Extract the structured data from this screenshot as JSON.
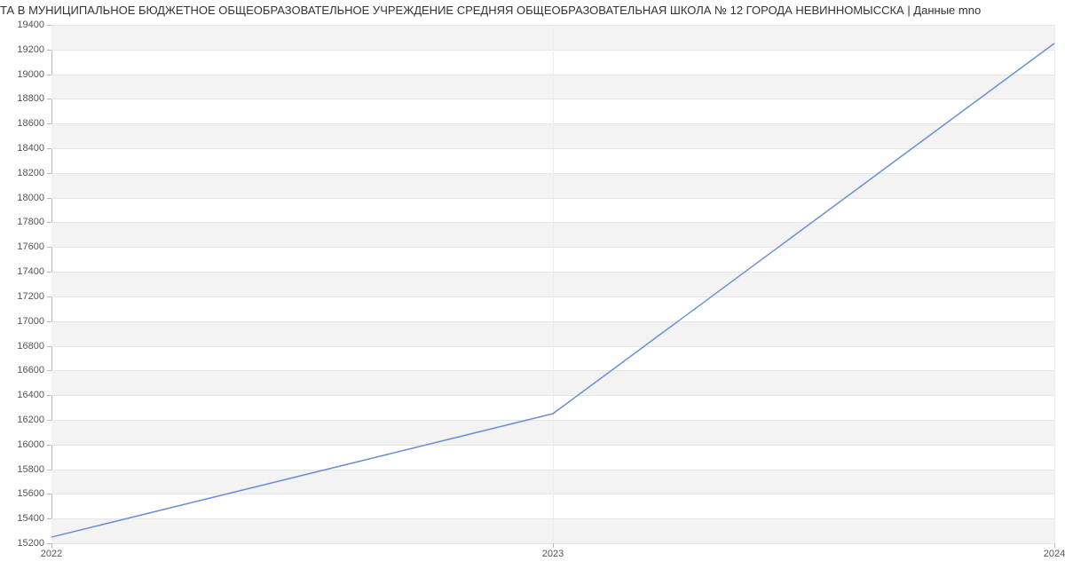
{
  "chart_data": {
    "type": "line",
    "title": "ТА В МУНИЦИПАЛЬНОЕ БЮДЖЕТНОЕ ОБЩЕОБРАЗОВАТЕЛЬНОЕ УЧРЕЖДЕНИЕ СРЕДНЯЯ ОБЩЕОБРАЗОВАТЕЛЬНАЯ ШКОЛА № 12 ГОРОДА НЕВИННОМЫССКА | Данные mno",
    "xlabel": "",
    "ylabel": "",
    "x": [
      2022,
      2023,
      2024
    ],
    "values": [
      15250,
      16250,
      19250
    ],
    "xlim": [
      2022,
      2024
    ],
    "ylim": [
      15200,
      19400
    ],
    "y_ticks": [
      15200,
      15400,
      15600,
      15800,
      16000,
      16200,
      16400,
      16600,
      16800,
      17000,
      17200,
      17400,
      17600,
      17800,
      18000,
      18200,
      18400,
      18600,
      18800,
      19000,
      19200,
      19400
    ],
    "x_ticks": [
      2022,
      2023,
      2024
    ]
  }
}
